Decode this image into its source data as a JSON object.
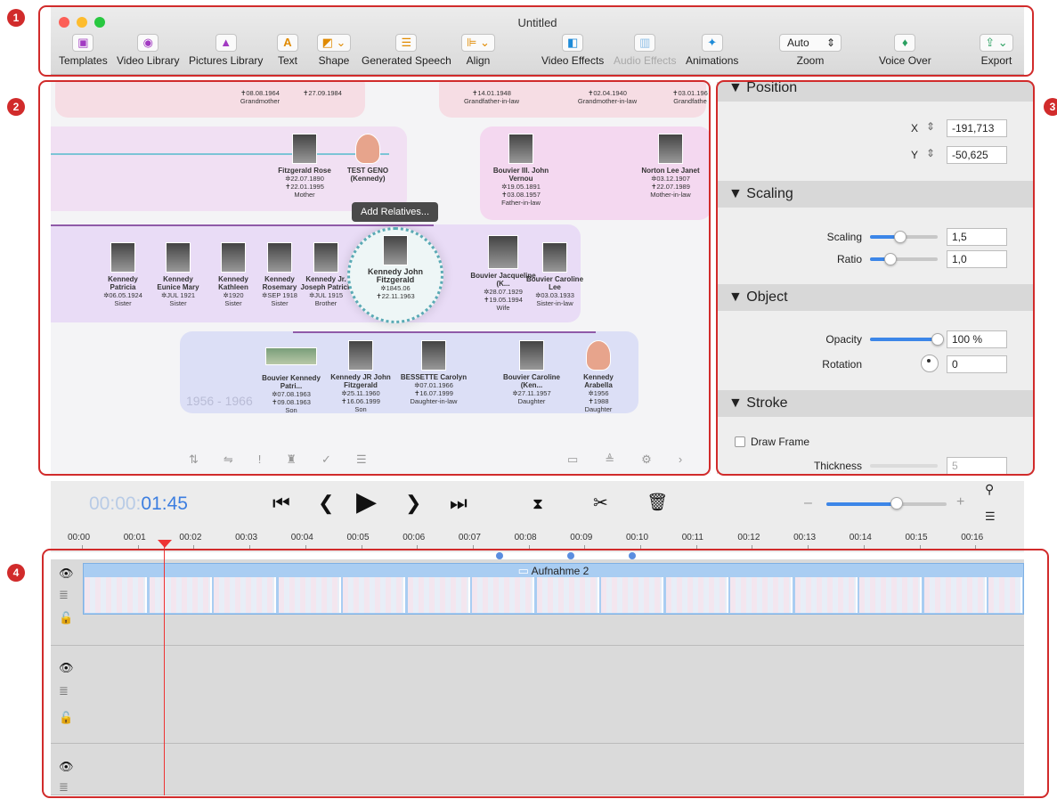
{
  "window": {
    "title": "Untitled"
  },
  "toolbar": {
    "templates": "Templates",
    "video_library": "Video Library",
    "pictures_library": "Pictures Library",
    "text": "Text",
    "shape": "Shape",
    "generated_speech": "Generated Speech",
    "align": "Align",
    "video_effects": "Video Effects",
    "audio_effects": "Audio Effects",
    "animations": "Animations",
    "zoom_value": "Auto",
    "zoom": "Zoom",
    "voice_over": "Voice Over",
    "export": "Export"
  },
  "badges": {
    "b1": "1",
    "b2": "2",
    "b3": "3",
    "b4": "4"
  },
  "canvas": {
    "tooltip": "Add Relatives...",
    "years": "1956 - 1966",
    "top_row": [
      {
        "date1": "✝08.08.1964",
        "role": "Grandmother"
      },
      {
        "date1": "✝27.09.1984",
        "role": ""
      },
      {
        "date1": "✝14.01.1948",
        "role": "Grandfather-in-law"
      },
      {
        "date1": "✝02.04.1940",
        "role": "Grandmother-in-law"
      },
      {
        "date1": "✝03.01.196",
        "role": "Grandfathe"
      }
    ],
    "parents": [
      {
        "name": "Fitzgerald Rose",
        "b": "✲22.07.1890",
        "d": "✝22.01.1995",
        "role": "Mother"
      },
      {
        "name": "TEST GENO (Kennedy)",
        "b": "",
        "d": "",
        "role": ""
      },
      {
        "name": "Bouvier III. John Vernou",
        "b": "✲19.05.1891",
        "d": "✝03.08.1957",
        "role": "Father-in-law"
      },
      {
        "name": "Norton Lee Janet",
        "b": "✲03.12.1907",
        "d": "✝22.07.1989",
        "role": "Mother-in-law"
      }
    ],
    "siblings": [
      {
        "name": "Kennedy Patricia",
        "b": "✲06.05.1924",
        "role": "Sister"
      },
      {
        "name": "Kennedy Eunice Mary",
        "b": "✲JUL 1921",
        "role": "Sister"
      },
      {
        "name": "Kennedy Kathleen",
        "b": "✲1920",
        "role": "Sister"
      },
      {
        "name": "Kennedy Rosemary",
        "b": "✲SEP 1918",
        "role": "Sister"
      },
      {
        "name": "Kennedy Jr. Joseph Patrick",
        "b": "✲JUL 1915",
        "role": "Brother"
      }
    ],
    "focus": {
      "name": "Kennedy John Fitzgerald",
      "b": "✲1845.06",
      "d": "✝22.11.1963"
    },
    "spouse": {
      "name": "Bouvier Jacqueline (K...",
      "b": "✲28.07.1929",
      "d": "✝19.05.1994",
      "role": "Wife"
    },
    "spouse_sib": {
      "name": "Bouvier Caroline Lee",
      "b": "✲03.03.1933",
      "role": "Sister-in-law"
    },
    "children": [
      {
        "name": "Bouvier Kennedy Patri...",
        "b": "✲07.08.1963",
        "d": "✝09.08.1963",
        "role": "Son"
      },
      {
        "name": "Kennedy JR John Fitzgerald",
        "b": "✲25.11.1960",
        "d": "✝16.06.1999",
        "role": "Son"
      },
      {
        "name": "BESSETTE Carolyn",
        "b": "✲07.01.1966",
        "d": "✝16.07.1999",
        "role": "Daughter-in-law"
      },
      {
        "name": "Bouvier Caroline (Ken...",
        "b": "✲27.11.1957",
        "d": "",
        "role": "Daughter"
      },
      {
        "name": "Kennedy Arabella",
        "b": "✲1956",
        "d": "✝1988",
        "role": "Daughter"
      }
    ]
  },
  "inspector": {
    "position": "Position",
    "x_label": "X",
    "x_value": "-191,713",
    "y_label": "Y",
    "y_value": "-50,625",
    "scaling_section": "Scaling",
    "scaling_label": "Scaling",
    "scaling_value": "1,5",
    "scaling_level": 0.45,
    "ratio_label": "Ratio",
    "ratio_value": "1,0",
    "ratio_level": 0.3,
    "object": "Object",
    "opacity_label": "Opacity",
    "opacity_value": "100 %",
    "opacity_level": 1.0,
    "rotation_label": "Rotation",
    "rotation_value": "0",
    "stroke": "Stroke",
    "draw_frame": "Draw Frame",
    "thickness_label": "Thickness",
    "thickness_value": "5"
  },
  "transport": {
    "timecode_dim": "00:00:",
    "timecode": "01:45",
    "ruler": [
      "00:00",
      "00:01",
      "00:02",
      "00:03",
      "00:04",
      "00:05",
      "00:06",
      "00:07",
      "00:08",
      "00:09",
      "00:10",
      "00:11",
      "00:12",
      "00:13",
      "00:14",
      "00:15",
      "00:16"
    ]
  },
  "timeline": {
    "clip_title": "Aufnahme 2"
  }
}
